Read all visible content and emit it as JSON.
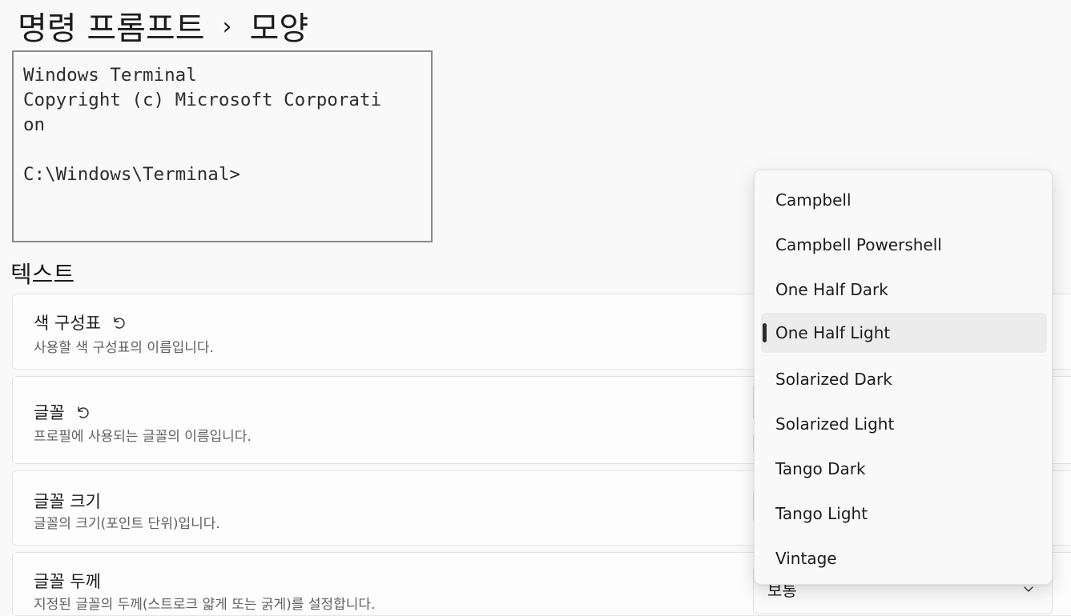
{
  "breadcrumb": {
    "parent": "명령 프롬프트",
    "separator": "›",
    "current": "모양"
  },
  "preview": {
    "lines": [
      "Windows Terminal",
      "Copyright (c) Microsoft Corporati",
      "on",
      "",
      "C:\\Windows\\Terminal>"
    ]
  },
  "section": {
    "title": "텍스트"
  },
  "settings": [
    {
      "title": "색 구성표",
      "description": "사용할 색 구성표의 이름입니다."
    },
    {
      "title": "글꼴",
      "description": "프로필에 사용되는 글꼴의 이름입니다."
    },
    {
      "title": "글꼴 크기",
      "description": "글꼴의 크기(포인트 단위)입니다."
    },
    {
      "title": "글꼴 두께",
      "description": "지정된 글꼴의 두께(스트로크 얇게 또는 굵게)를 설정합니다."
    }
  ],
  "font_weight": {
    "value": "보통"
  },
  "color_scheme_options": [
    "Campbell",
    "Campbell Powershell",
    "One Half Dark",
    "One Half Light",
    "Solarized Dark",
    "Solarized Light",
    "Tango Dark",
    "Tango Light",
    "Vintage"
  ],
  "selected_scheme": "One Half Light",
  "icons": {
    "reset": "reset-icon",
    "chevron": "chevron-down-icon"
  }
}
